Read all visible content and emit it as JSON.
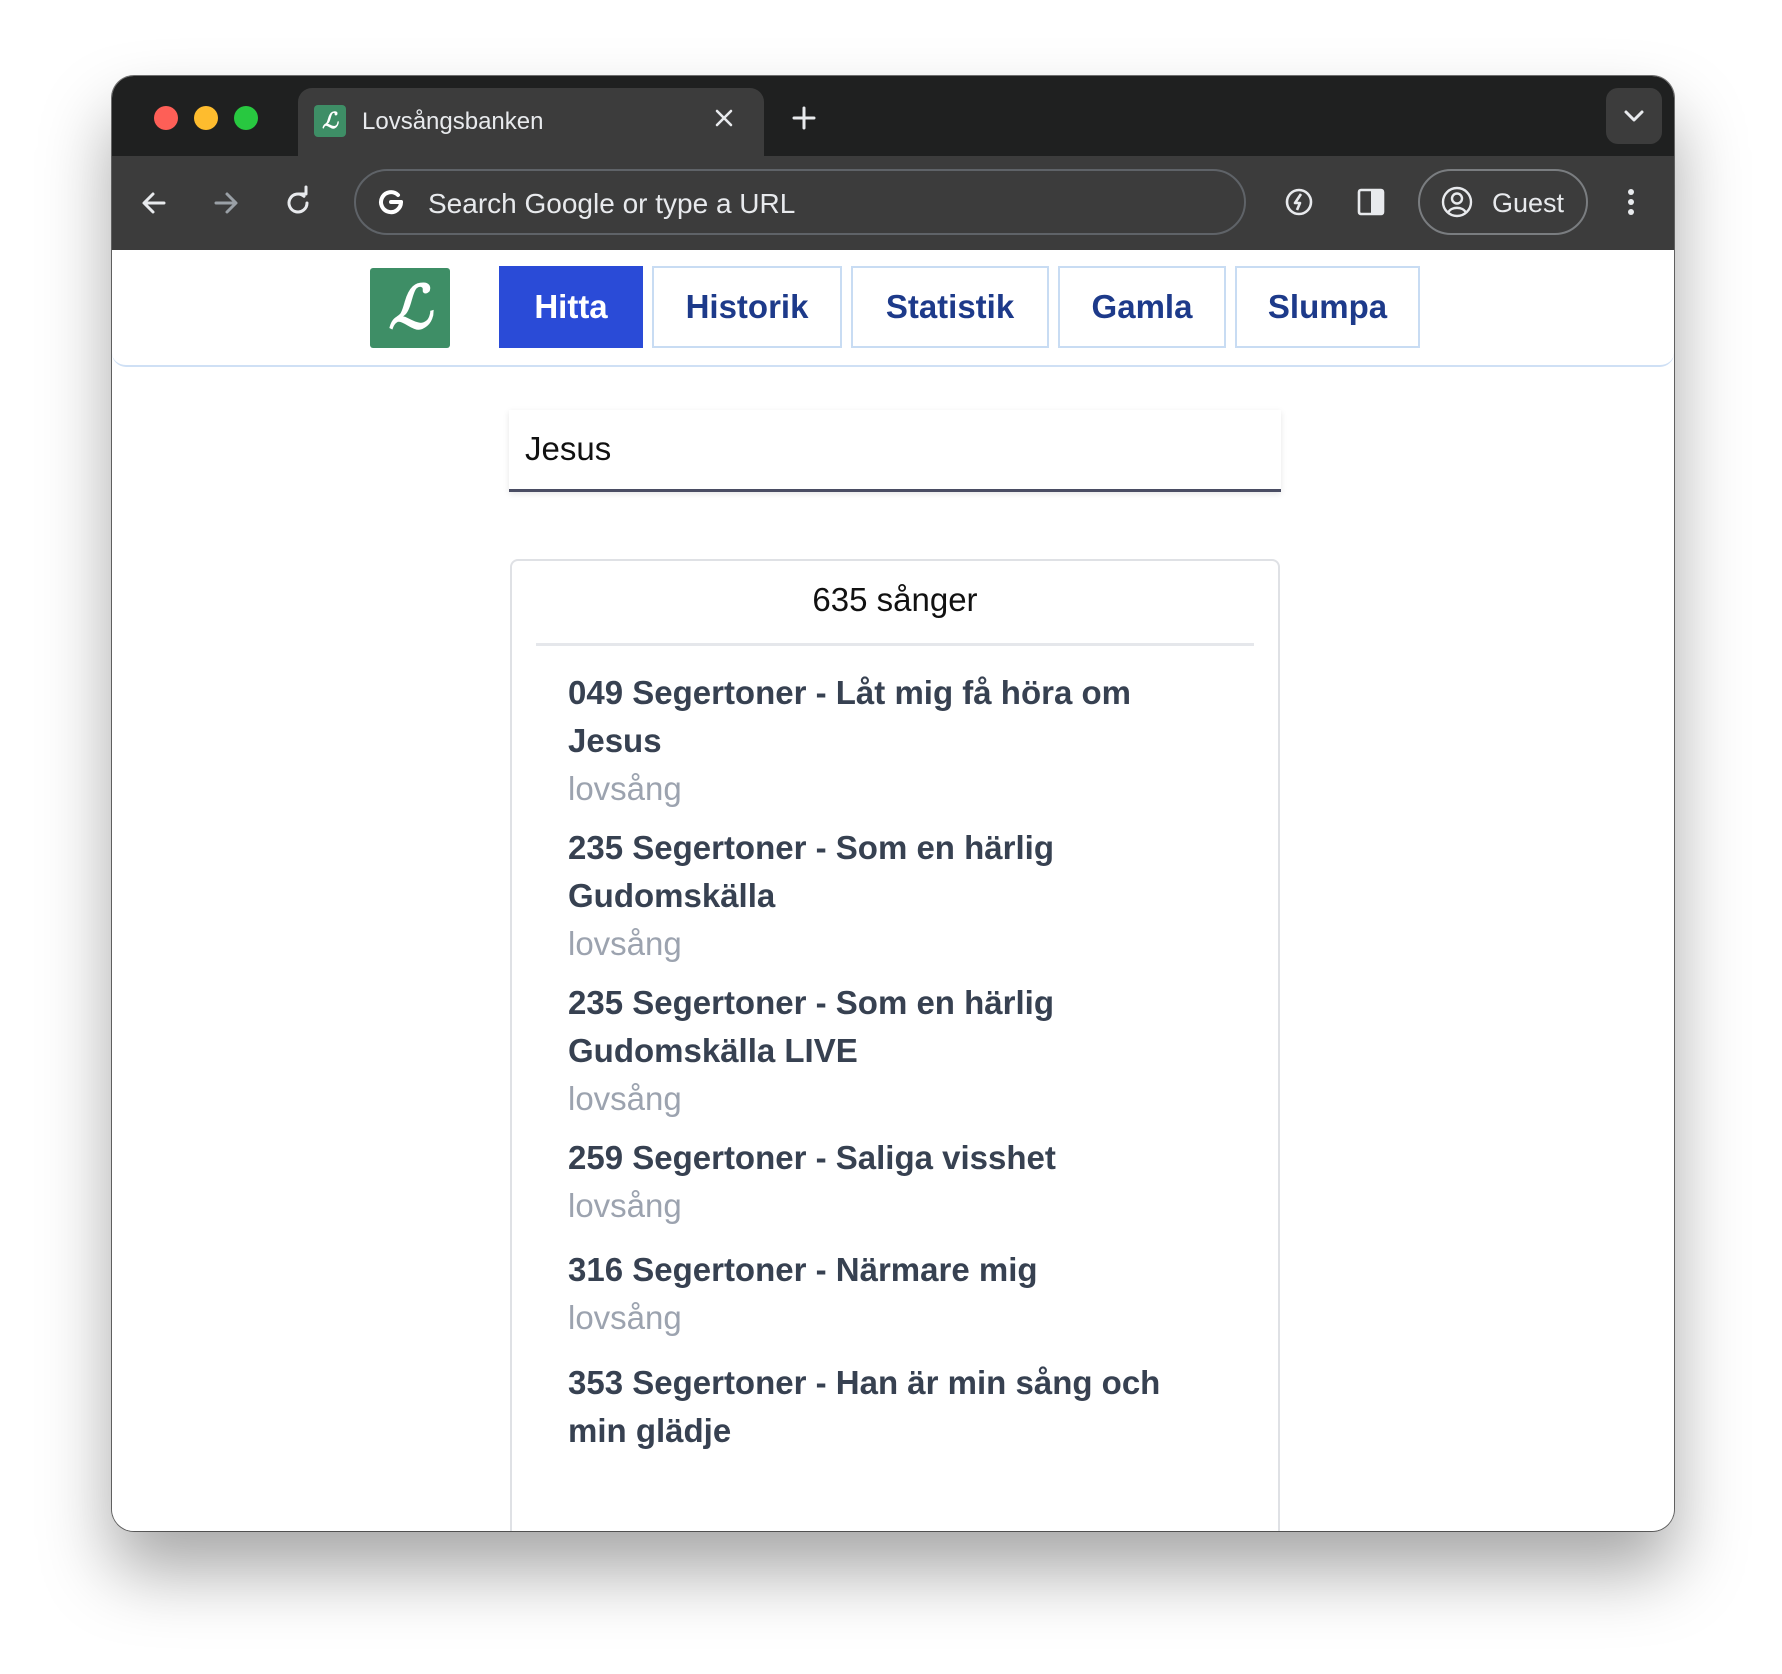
{
  "browser": {
    "tab_title": "Lovsångsbanken",
    "favicon_letter": "ℒ",
    "omnibox_placeholder": "Search Google or type a URL",
    "profile_label": "Guest"
  },
  "site": {
    "logo_letter": "ℒ",
    "nav": [
      {
        "label": "Hitta",
        "active": true
      },
      {
        "label": "Historik",
        "active": false
      },
      {
        "label": "Statistik",
        "active": false
      },
      {
        "label": "Gamla",
        "active": false
      },
      {
        "label": "Slumpa",
        "active": false
      }
    ],
    "search_value": "Jesus",
    "result_count": "635 sånger",
    "songs": [
      {
        "title": "049 Segertoner - Låt mig få höra om Jesus",
        "category": "lovsång"
      },
      {
        "title": "235 Segertoner - Som en härlig Gudomskälla",
        "category": "lovsång"
      },
      {
        "title": "235 Segertoner - Som en härlig Gudomskälla LIVE",
        "category": "lovsång"
      },
      {
        "title": "259 Segertoner - Saliga visshet",
        "category": "lovsång"
      },
      {
        "title": "316 Segertoner - Närmare mig",
        "category": "lovsång"
      },
      {
        "title": "353 Segertoner - Han är min sång och min glädje",
        "category": ""
      }
    ]
  },
  "colors": {
    "logo_green": "#3e8e66",
    "active_nav": "#2a4bd7",
    "nav_text": "#1d3a8a"
  }
}
